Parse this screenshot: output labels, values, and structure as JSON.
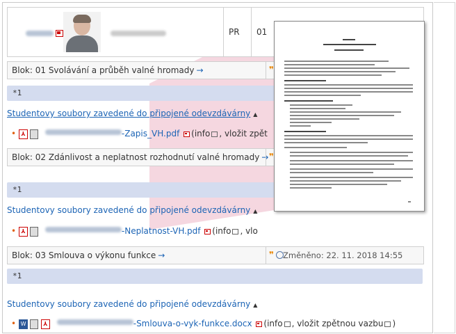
{
  "student": {
    "program": "PR",
    "semester": "01"
  },
  "blocks": [
    {
      "title_prefix": "Blok:",
      "title": "01 Svolávání a průběh valné hromady",
      "arrow": "→",
      "star_text": "*1",
      "files_header": "Studentovy soubory zavedené do připojené odevzdávárny",
      "file_suffix": "-Zapis_VH.pdf",
      "file_actions": "(info",
      "file_actions_2": ", vložit zpět"
    },
    {
      "title_prefix": "Blok:",
      "title": "02 Zdánlivost a neplatnost rozhodnutí valné hromady",
      "arrow": "→",
      "star_text": "*1",
      "files_header": "Studentovy soubory zavedené do připojené odevzdávárny",
      "file_suffix": "-Neplatnost-VH.pdf",
      "file_actions": "(info",
      "file_actions_2": ", vlo"
    },
    {
      "title_prefix": "Blok:",
      "title": "03 Smlouva o výkonu funkce",
      "arrow": "→",
      "status": "Změněno: 22. 11. 2018 14:55",
      "star_text": "*1",
      "files_header": "Studentovy soubory zavedené do připojené odevzdávárny",
      "file_suffix": "-Smlouva-o-vyk-funkce.docx",
      "file_actions": "(info",
      "file_actions_2": ", vložit zpětnou vazbu",
      "file_actions_3": ")"
    }
  ],
  "icons": {
    "toggle": "▲",
    "bullet": "•"
  },
  "colors": {
    "link": "#1c64b5",
    "star_band": "#d4dcef",
    "cone": "#f2c9d6"
  }
}
